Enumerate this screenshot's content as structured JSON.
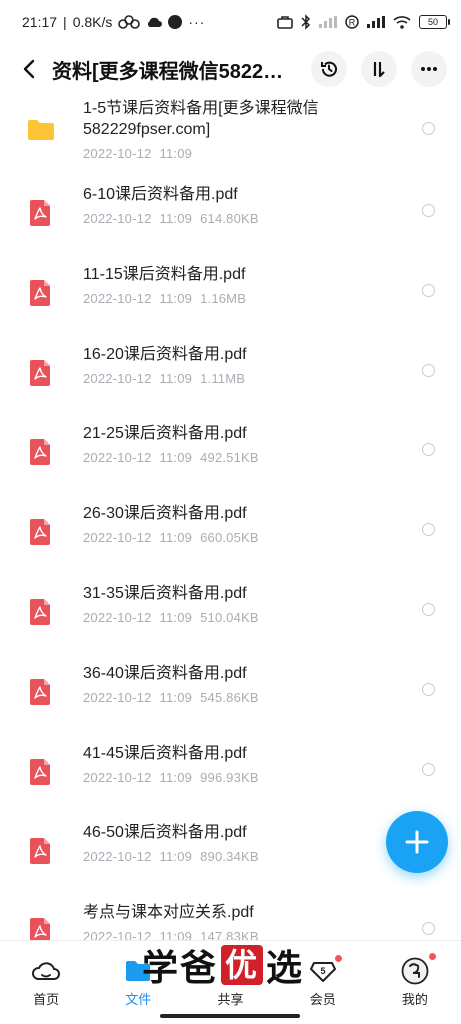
{
  "status_bar": {
    "time": "21:17",
    "speed": "0.8K/s",
    "battery": "50"
  },
  "header": {
    "title": "资料[更多课程微信58222...",
    "back_icon": "chevron-left-icon",
    "history_icon": "history-icon",
    "sort_icon": "sort-icon",
    "more_icon": "more-horizontal-icon"
  },
  "files": [
    {
      "name": "1-5节课后资料备用[更多课程微信582229fpser.com]",
      "date": "2022-10-12",
      "time": "11:09",
      "size": "",
      "type": "folder"
    },
    {
      "name": "6-10课后资料备用.pdf",
      "date": "2022-10-12",
      "time": "11:09",
      "size": "614.80KB",
      "type": "pdf"
    },
    {
      "name": "11-15课后资料备用.pdf",
      "date": "2022-10-12",
      "time": "11:09",
      "size": "1.16MB",
      "type": "pdf"
    },
    {
      "name": "16-20课后资料备用.pdf",
      "date": "2022-10-12",
      "time": "11:09",
      "size": "1.11MB",
      "type": "pdf"
    },
    {
      "name": "21-25课后资料备用.pdf",
      "date": "2022-10-12",
      "time": "11:09",
      "size": "492.51KB",
      "type": "pdf"
    },
    {
      "name": "26-30课后资料备用.pdf",
      "date": "2022-10-12",
      "time": "11:09",
      "size": "660.05KB",
      "type": "pdf"
    },
    {
      "name": "31-35课后资料备用.pdf",
      "date": "2022-10-12",
      "time": "11:09",
      "size": "510.04KB",
      "type": "pdf"
    },
    {
      "name": "36-40课后资料备用.pdf",
      "date": "2022-10-12",
      "time": "11:09",
      "size": "545.86KB",
      "type": "pdf"
    },
    {
      "name": "41-45课后资料备用.pdf",
      "date": "2022-10-12",
      "time": "11:09",
      "size": "996.93KB",
      "type": "pdf"
    },
    {
      "name": "46-50课后资料备用.pdf",
      "date": "2022-10-12",
      "time": "11:09",
      "size": "890.34KB",
      "type": "pdf"
    },
    {
      "name": "考点与课本对应关系.pdf",
      "date": "2022-10-12",
      "time": "11:09",
      "size": "147.83KB",
      "type": "pdf"
    }
  ],
  "fab": {
    "icon": "plus-icon"
  },
  "bottom_nav": [
    {
      "label": "首页",
      "icon": "home-cloud-icon",
      "active": false
    },
    {
      "label": "文件",
      "icon": "folder-icon",
      "active": true
    },
    {
      "label": "共享",
      "icon": "share-icon",
      "active": false
    },
    {
      "label": "会员",
      "icon": "vip-diamond-icon",
      "active": false
    },
    {
      "label": "我的",
      "icon": "avatar-icon",
      "active": false
    }
  ],
  "watermark": {
    "text_left": "学爸",
    "seal": "优",
    "text_right": "选"
  },
  "colors": {
    "accent": "#1aa3f5",
    "active_tab": "#1a90f0",
    "pdf_red": "#e9525a",
    "folder_yellow": "#fdc436",
    "meta_gray": "#a9adb3",
    "badge_red": "#f2555e"
  }
}
